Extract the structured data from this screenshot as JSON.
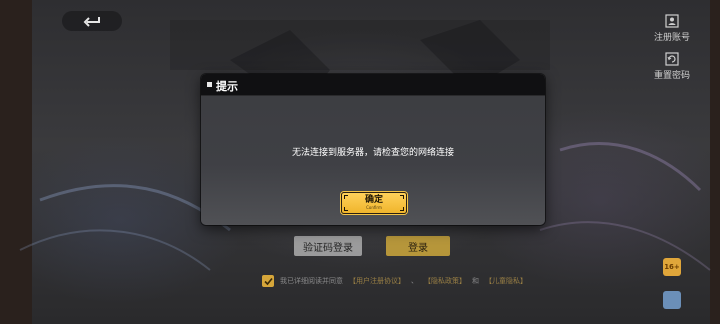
{
  "header": {
    "back_icon": "back-arrow-icon",
    "tools": [
      {
        "icon": "register-account-icon",
        "label": "注册账号"
      },
      {
        "icon": "reset-password-icon",
        "label": "重置密码"
      }
    ]
  },
  "login": {
    "code_login_label": "验证码登录",
    "login_label": "登录",
    "agreement": {
      "prefix": "我已详细阅读并同意",
      "link1": "【用户注册协议】",
      "sep": "、",
      "link2": "【隐私政策】",
      "and": "和",
      "link3": "【儿童隐私】"
    }
  },
  "badges": {
    "age_label": "16+",
    "age_icon": "age-rating-icon",
    "cert_icon": "certification-icon"
  },
  "modal": {
    "title": "提示",
    "message": "无法连接到服务器，请检查您的网络连接",
    "confirm_label": "确定",
    "confirm_sub": "Confirm"
  },
  "colors": {
    "accent": "#F0B52C",
    "panel": "#3C3D41",
    "header": "#101012"
  }
}
